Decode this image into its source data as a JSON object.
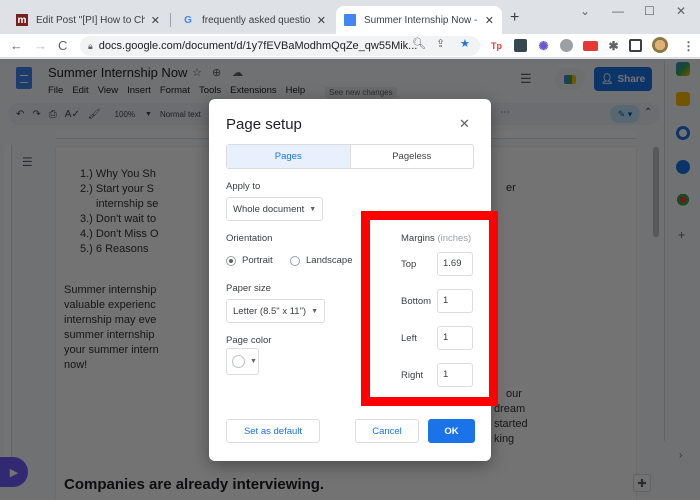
{
  "browser": {
    "tabs": [
      {
        "title": "Edit Post \"[PI] How to Change",
        "favicon": "m",
        "active": false
      },
      {
        "title": "frequently asked questions ab",
        "favicon": "G",
        "active": false
      },
      {
        "title": "Summer Internship Now - Goo",
        "favicon": "docs",
        "active": true
      }
    ],
    "new_tab": "+",
    "window_controls": {
      "tab_search": "⌄",
      "minimize": "—",
      "maximize": "☐",
      "close": "✕"
    },
    "nav": {
      "back": "←",
      "forward": "→",
      "reload": "C"
    },
    "url": "docs.google.com/document/d/1y7fEVBaModhmQqZe_qw55Mik...",
    "extensions": [
      "Tp",
      "ext-dark",
      "ext-sun",
      "ext-gray",
      "ext-red",
      "puzzle",
      "sidepanel"
    ],
    "more": "⋮"
  },
  "docs": {
    "title": "Summer Internship Now",
    "menu": [
      "File",
      "Edit",
      "View",
      "Insert",
      "Format",
      "Tools",
      "Extensions",
      "Help"
    ],
    "see_changes": "See new changes",
    "share_label": "Share",
    "toolbar": {
      "zoom": "100%",
      "style": "Normal text"
    },
    "list_items": [
      "1.) Why You Sh",
      "2.) Start your S",
      "internship se",
      "3.) Don't wait to",
      "4.) Don't Miss O",
      "5.)  6 Reasons"
    ],
    "list_right_fragment": "er",
    "paragraph_lines": [
      "Summer internship",
      "valuable experienc",
      "internship may eve",
      "summer internship",
      "your summer intern",
      "now!"
    ],
    "paragraph_right_lines": [
      "our",
      "dream",
      "started",
      "king"
    ],
    "heading": "Companies are already interviewing."
  },
  "dialog": {
    "title": "Page setup",
    "close": "✕",
    "tabs": [
      {
        "label": "Pages",
        "active": true
      },
      {
        "label": "Pageless",
        "active": false
      }
    ],
    "apply_to": {
      "label": "Apply to",
      "value": "Whole document"
    },
    "orientation": {
      "label": "Orientation",
      "options": [
        {
          "label": "Portrait",
          "selected": true
        },
        {
          "label": "Landscape",
          "selected": false
        }
      ]
    },
    "paper_size": {
      "label": "Paper size",
      "value": "Letter (8.5\" x 11\")"
    },
    "page_color": {
      "label": "Page color",
      "value": "#ffffff"
    },
    "margins": {
      "label": "Margins",
      "unit": "(inches)",
      "fields": [
        {
          "label": "Top",
          "value": "1.69"
        },
        {
          "label": "Bottom",
          "value": "1"
        },
        {
          "label": "Left",
          "value": "1"
        },
        {
          "label": "Right",
          "value": "1"
        }
      ]
    },
    "buttons": {
      "set_default": "Set as default",
      "cancel": "Cancel",
      "ok": "OK"
    }
  },
  "colors": {
    "accent": "#1a73e8",
    "highlight": "#ff0000",
    "tab_active_bg": "#e8f0fe"
  }
}
